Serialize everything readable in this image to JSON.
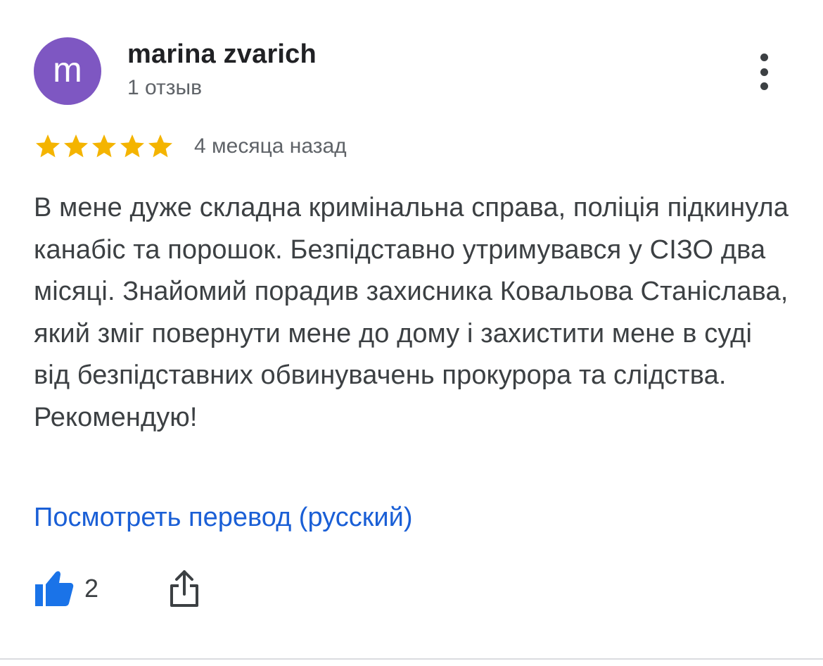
{
  "review": {
    "author": {
      "avatar_letter": "m",
      "avatar_color": "#7e57c2",
      "name": "marina zvarich",
      "meta": "1 отзыв"
    },
    "rating": {
      "stars": 5,
      "max_stars": 5,
      "star_color": "#f4b400"
    },
    "time_ago": "4 месяца назад",
    "text": "В мене дуже складна кримінальна справа, поліція підкинула канабіс та порошок. Безпідставно утримувався у СІЗО два місяці. Знайомий порадив захисника Ковальова Станіслава, який зміг повернути мене до дому і захистити мене в суді від безпідставних обвинувачень прокурора та слідства. Рекомендую!",
    "translate_link": "Посмотреть перевод (русский)",
    "link_color": "#1a5fd6",
    "likes": {
      "icon": "thumbs-up-icon",
      "count": "2",
      "icon_color": "#1a73e8"
    },
    "share": {
      "icon": "share-icon"
    },
    "more_menu": {
      "icon": "more-vertical-icon"
    }
  }
}
